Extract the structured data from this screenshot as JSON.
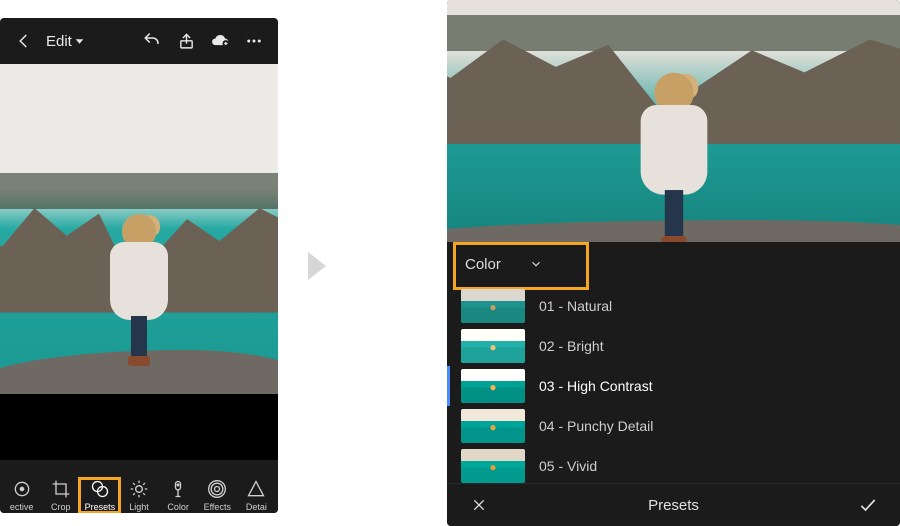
{
  "left": {
    "editLabel": "Edit",
    "tools": {
      "selective": "ective",
      "crop": "Crop",
      "presets": "Presets",
      "light": "Light",
      "color": "Color",
      "effects": "Effects",
      "detail": "Detai"
    }
  },
  "right": {
    "category": "Color",
    "presets": [
      {
        "label": "01 - Natural",
        "variant": "natural"
      },
      {
        "label": "02 - Bright",
        "variant": "bright"
      },
      {
        "label": "03 - High Contrast",
        "variant": "hc",
        "selected": true
      },
      {
        "label": "04 - Punchy Detail",
        "variant": "punchy"
      },
      {
        "label": "05 - Vivid",
        "variant": "vivid"
      }
    ],
    "bottombarTitle": "Presets"
  }
}
